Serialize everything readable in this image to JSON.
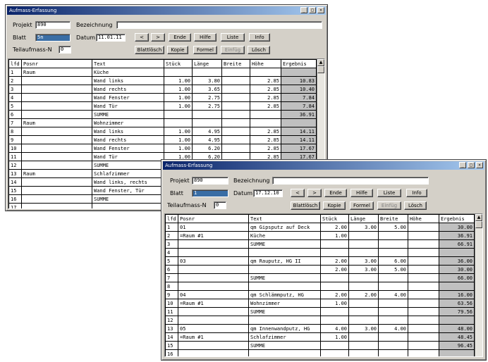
{
  "win1": {
    "title": "Aufmass-Erfassung",
    "labels": {
      "projekt": "Projekt",
      "bezeichnung": "Bezeichnung",
      "blatt": "Blatt",
      "datum": "Datum",
      "teilaufmass": "Teilaufmass-N"
    },
    "values": {
      "projekt": "890",
      "bezeichnung": "",
      "blatt": "5n",
      "datum": "11.01.11",
      "teilaufmass": "0"
    },
    "buttons": {
      "prev": "<",
      "next": ">",
      "ende": "Ende",
      "hilfe": "Hilfe",
      "liste": "Liste",
      "info": "Info",
      "blattloesch": "Blattlösch",
      "kopie": "Kopie",
      "formel": "Formel",
      "einfueg": "Einfüg",
      "loesch": "Lösch"
    },
    "columns": [
      "lfd",
      "Posnr",
      "Text",
      "Stück",
      "Länge",
      "Breite",
      "Höhe",
      "Ergebnis"
    ],
    "rows": [
      [
        "1",
        "Raum",
        "Küche",
        "",
        "",
        "",
        "",
        ""
      ],
      [
        "2",
        "",
        "Wand links",
        "1.00",
        "3.80",
        "",
        "2.85",
        "10.83"
      ],
      [
        "3",
        "",
        "Wand rechts",
        "1.00",
        "3.65",
        "",
        "2.85",
        "10.40"
      ],
      [
        "4",
        "",
        "Wand Fenster",
        "1.00",
        "2.75",
        "",
        "2.85",
        "7.84"
      ],
      [
        "5",
        "",
        "Wand Tür",
        "1.00",
        "2.75",
        "",
        "2.85",
        "7.84"
      ],
      [
        "6",
        "",
        "SUMME",
        "",
        "",
        "",
        "",
        "36.91"
      ],
      [
        "7",
        "Raum",
        "Wohnzimmer",
        "",
        "",
        "",
        "",
        ""
      ],
      [
        "8",
        "",
        "Wand links",
        "1.00",
        "4.95",
        "",
        "2.85",
        "14.11"
      ],
      [
        "9",
        "",
        "Wand rechts",
        "1.00",
        "4.95",
        "",
        "2.85",
        "14.11"
      ],
      [
        "10",
        "",
        "Wand Fenster",
        "1.00",
        "6.20",
        "",
        "2.85",
        "17.67"
      ],
      [
        "11",
        "",
        "Wand Tür",
        "1.00",
        "6.20",
        "",
        "2.85",
        "17.67"
      ],
      [
        "12",
        "",
        "SUMME",
        "",
        "",
        "",
        "",
        ""
      ],
      [
        "13",
        "Raum",
        "Schlafzimmer",
        "",
        "",
        "",
        "",
        ""
      ],
      [
        "14",
        "",
        "Wand links, rechts",
        "",
        "",
        "",
        "",
        ""
      ],
      [
        "15",
        "",
        "Wand Fenster, Tür",
        "",
        "",
        "",
        "",
        ""
      ],
      [
        "16",
        "",
        "SUMME",
        "",
        "",
        "",
        "",
        ""
      ],
      [
        "17",
        "",
        "",
        "",
        "",
        "",
        "",
        ""
      ]
    ]
  },
  "win2": {
    "title": "Aufmass-Erfassung",
    "labels": {
      "projekt": "Projekt",
      "bezeichnung": "Bezeichnung",
      "blatt": "Blatt",
      "datum": "Datum",
      "teilaufmass": "Teilaufmass-N"
    },
    "values": {
      "projekt": "890",
      "bezeichnung": "",
      "blatt": "1",
      "datum": "17.12.10",
      "teilaufmass": "0"
    },
    "buttons": {
      "prev": "<",
      "next": ">",
      "ende": "Ende",
      "hilfe": "Hilfe",
      "liste": "Liste",
      "info": "Info",
      "blattloesch": "Blattlösch",
      "kopie": "Kopie",
      "formel": "Formel",
      "einfueg": "Einfüg",
      "loesch": "Lösch"
    },
    "columns": [
      "lfd",
      "Posnr",
      "Text",
      "Stück",
      "Länge",
      "Breite",
      "Höhe",
      "Ergebnis"
    ],
    "rows": [
      [
        "1",
        "01",
        "qm Gipsputz auf Deck",
        "2.00",
        "3.00",
        "5.00",
        "",
        "30.00"
      ],
      [
        "2",
        "=Raum #1",
        "Küche",
        "1.00",
        "",
        "",
        "",
        "36.91"
      ],
      [
        "3",
        "",
        "SUMME",
        "",
        "",
        "",
        "",
        "66.91"
      ],
      [
        "4",
        "",
        "",
        "",
        "",
        "",
        "",
        ""
      ],
      [
        "5",
        "03",
        "qm Rauputz, HG II",
        "2.00",
        "3.00",
        "6.00",
        "",
        "36.00"
      ],
      [
        "6",
        "",
        "",
        "2.00",
        "3.00",
        "5.00",
        "",
        "30.00"
      ],
      [
        "7",
        "",
        "SUMME",
        "",
        "",
        "",
        "",
        "66.00"
      ],
      [
        "8",
        "",
        "",
        "",
        "",
        "",
        "",
        ""
      ],
      [
        "9",
        "04",
        "qm Schlämmputz, HG",
        "2.00",
        "2.00",
        "4.00",
        "",
        "16.00"
      ],
      [
        "10",
        "=Raum #1",
        "Wohnzimmer",
        "1.00",
        "",
        "",
        "",
        "63.56"
      ],
      [
        "11",
        "",
        "SUMME",
        "",
        "",
        "",
        "",
        "79.56"
      ],
      [
        "12",
        "",
        "",
        "",
        "",
        "",
        "",
        ""
      ],
      [
        "13",
        "05",
        "qm Innenwandputz, HG",
        "4.00",
        "3.00",
        "4.00",
        "",
        "48.00"
      ],
      [
        "14",
        "=Raum #1",
        "Schlafzimmer",
        "1.00",
        "",
        "",
        "",
        "48.45"
      ],
      [
        "15",
        "",
        "SUMME",
        "",
        "",
        "",
        "",
        "96.45"
      ],
      [
        "16",
        "",
        "",
        "",
        "",
        "",
        "",
        ""
      ]
    ]
  },
  "colors": {
    "title_from": "#0a246a",
    "title_to": "#a6caf0",
    "face": "#d4d0c8",
    "selected": "#3a6ea5",
    "result_cell": "#c0c0c0"
  }
}
